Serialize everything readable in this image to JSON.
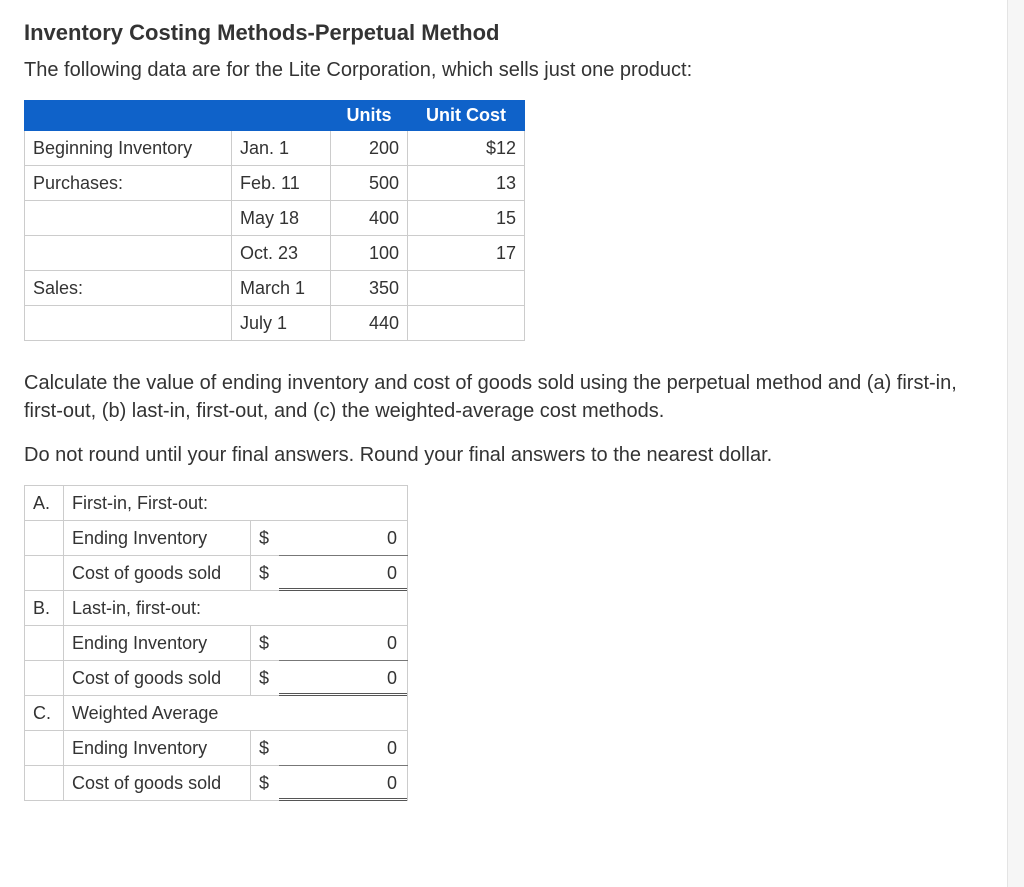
{
  "title": "Inventory Costing Methods-Perpetual Method",
  "intro": "The following data are for the Lite Corporation, which sells just one product:",
  "data_table": {
    "headers": {
      "units": "Units",
      "unit_cost": "Unit Cost"
    },
    "rows": [
      {
        "label": "Beginning Inventory",
        "date": "Jan. 1",
        "units": "200",
        "cost": "$12"
      },
      {
        "label": "Purchases:",
        "date": "Feb. 11",
        "units": "500",
        "cost": "13"
      },
      {
        "label": "",
        "date": "May 18",
        "units": "400",
        "cost": "15"
      },
      {
        "label": "",
        "date": "Oct. 23",
        "units": "100",
        "cost": "17"
      },
      {
        "label": "Sales:",
        "date": "March 1",
        "units": "350",
        "cost": ""
      },
      {
        "label": "",
        "date": "July 1",
        "units": "440",
        "cost": ""
      }
    ]
  },
  "instruction": "Calculate the value of ending inventory and cost of goods sold using the perpetual method and (a) first-in, first-out, (b) last-in, first-out, and (c) the weighted-average cost methods.",
  "rounding": "Do not round until your final answers. Round your final answers to the nearest dollar.",
  "answers": {
    "sections": [
      {
        "letter": "A.",
        "name": "First-in, First-out:",
        "ei_sym": "$",
        "ei_val": "0",
        "cogs_sym": "$",
        "cogs_val": "0"
      },
      {
        "letter": "B.",
        "name": "Last-in, first-out:",
        "ei_sym": "$",
        "ei_val": "0",
        "cogs_sym": "$",
        "cogs_val": "0"
      },
      {
        "letter": "C.",
        "name": "Weighted Average",
        "ei_sym": "$",
        "ei_val": "0",
        "cogs_sym": "$",
        "cogs_val": "0"
      }
    ],
    "labels": {
      "ei": "Ending Inventory",
      "cogs": "Cost of goods sold"
    }
  }
}
